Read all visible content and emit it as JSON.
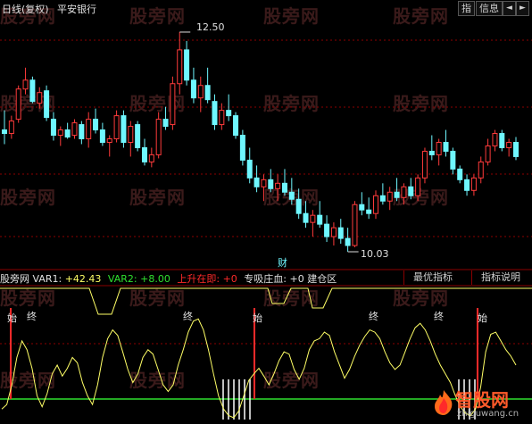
{
  "header": {
    "period": "日线(复权)",
    "stock_name": "平安银行",
    "buttons": [
      "指",
      "信息"
    ],
    "arrow_left": "◄",
    "arrow_right": "►"
  },
  "watermark": "股旁网",
  "price_panel": {
    "high_label": "12.50",
    "low_label": "10.03",
    "finance_marker": "财",
    "up_color": "#ff3b3b",
    "down_color": "#6ff7ff",
    "candles": [
      [
        11.4,
        11.62,
        11.24,
        11.36
      ],
      [
        11.36,
        11.56,
        11.3,
        11.5
      ],
      [
        11.52,
        11.9,
        11.48,
        11.86
      ],
      [
        11.86,
        12.1,
        11.8,
        11.96
      ],
      [
        11.96,
        12.0,
        11.7,
        11.72
      ],
      [
        11.7,
        11.88,
        11.64,
        11.82
      ],
      [
        11.84,
        11.9,
        11.5,
        11.54
      ],
      [
        11.52,
        11.6,
        11.28,
        11.34
      ],
      [
        11.34,
        11.44,
        11.22,
        11.4
      ],
      [
        11.4,
        11.48,
        11.3,
        11.32
      ],
      [
        11.34,
        11.52,
        11.3,
        11.48
      ],
      [
        11.46,
        11.5,
        11.24,
        11.3
      ],
      [
        11.3,
        11.6,
        11.2,
        11.52
      ],
      [
        11.52,
        11.64,
        11.36,
        11.4
      ],
      [
        11.4,
        11.48,
        11.22,
        11.26
      ],
      [
        11.26,
        11.34,
        11.1,
        11.3
      ],
      [
        11.3,
        11.62,
        11.26,
        11.56
      ],
      [
        11.56,
        11.62,
        11.2,
        11.26
      ],
      [
        11.26,
        11.5,
        11.1,
        11.44
      ],
      [
        11.46,
        11.5,
        11.16,
        11.2
      ],
      [
        11.2,
        11.3,
        11.0,
        11.04
      ],
      [
        11.04,
        11.2,
        10.98,
        11.12
      ],
      [
        11.12,
        11.6,
        11.08,
        11.52
      ],
      [
        11.52,
        11.66,
        11.4,
        11.44
      ],
      [
        11.46,
        12.0,
        11.4,
        11.92
      ],
      [
        11.92,
        12.5,
        11.8,
        12.3
      ],
      [
        12.3,
        12.4,
        11.9,
        11.96
      ],
      [
        11.96,
        12.1,
        11.7,
        11.76
      ],
      [
        11.76,
        12.0,
        11.6,
        11.9
      ],
      [
        11.9,
        12.1,
        11.7,
        11.74
      ],
      [
        11.72,
        11.8,
        11.4,
        11.46
      ],
      [
        11.46,
        11.7,
        11.4,
        11.62
      ],
      [
        11.62,
        11.8,
        11.5,
        11.56
      ],
      [
        11.56,
        11.6,
        11.3,
        11.34
      ],
      [
        11.34,
        11.4,
        11.0,
        11.06
      ],
      [
        11.06,
        11.2,
        10.8,
        10.86
      ],
      [
        10.86,
        11.0,
        10.7,
        10.76
      ],
      [
        10.76,
        10.9,
        10.6,
        10.84
      ],
      [
        10.84,
        10.96,
        10.7,
        10.74
      ],
      [
        10.74,
        10.9,
        10.6,
        10.8
      ],
      [
        10.8,
        10.96,
        10.66,
        10.7
      ],
      [
        10.7,
        10.86,
        10.56,
        10.62
      ],
      [
        10.62,
        10.74,
        10.4,
        10.46
      ],
      [
        10.46,
        10.6,
        10.3,
        10.36
      ],
      [
        10.36,
        10.5,
        10.2,
        10.44
      ],
      [
        10.44,
        10.6,
        10.3,
        10.34
      ],
      [
        10.34,
        10.44,
        10.14,
        10.2
      ],
      [
        10.2,
        10.36,
        10.1,
        10.3
      ],
      [
        10.3,
        10.4,
        10.12,
        10.18
      ],
      [
        10.18,
        10.3,
        10.03,
        10.1
      ],
      [
        10.1,
        10.6,
        10.08,
        10.56
      ],
      [
        10.56,
        10.7,
        10.44,
        10.5
      ],
      [
        10.5,
        10.64,
        10.4,
        10.46
      ],
      [
        10.46,
        10.72,
        10.4,
        10.66
      ],
      [
        10.66,
        10.8,
        10.56,
        10.6
      ],
      [
        10.6,
        10.76,
        10.5,
        10.7
      ],
      [
        10.7,
        10.86,
        10.6,
        10.64
      ],
      [
        10.64,
        10.8,
        10.56,
        10.76
      ],
      [
        10.76,
        10.86,
        10.62,
        10.66
      ],
      [
        10.66,
        10.9,
        10.6,
        10.86
      ],
      [
        10.86,
        11.2,
        10.8,
        11.16
      ],
      [
        11.16,
        11.34,
        11.06,
        11.12
      ],
      [
        11.12,
        11.3,
        11.0,
        11.26
      ],
      [
        11.26,
        11.4,
        11.1,
        11.16
      ],
      [
        11.16,
        11.2,
        10.9,
        10.96
      ],
      [
        10.96,
        11.0,
        10.8,
        10.84
      ],
      [
        10.84,
        10.9,
        10.66,
        10.72
      ],
      [
        10.72,
        10.9,
        10.66,
        10.86
      ],
      [
        10.86,
        11.1,
        10.8,
        11.04
      ],
      [
        11.04,
        11.3,
        11.0,
        11.22
      ],
      [
        11.22,
        11.4,
        11.16,
        11.36
      ],
      [
        11.36,
        11.4,
        11.16,
        11.2
      ],
      [
        11.2,
        11.3,
        11.1,
        11.26
      ],
      [
        11.26,
        11.32,
        11.06,
        11.1
      ]
    ]
  },
  "indicator_panel": {
    "name": "股旁网",
    "var1_label": "VAR1:",
    "var1_value": "+42.43",
    "var2_label": "VAR2:",
    "var2_value": "+8.00",
    "var3_label": "上升在即:",
    "var3_value": "+0",
    "var4_label": "专吸庄血:",
    "var4_value": "+0",
    "tail_text": "建仓区",
    "tabs": [
      "最优指标",
      "指标说明"
    ],
    "signal_start": "始",
    "signal_end": "终",
    "line_color": "#ffff66",
    "green_color": "#2fe02f",
    "signal_color": "#ff2a2a",
    "series": [
      8,
      12,
      30,
      55,
      70,
      62,
      45,
      20,
      10,
      22,
      40,
      48,
      38,
      45,
      55,
      50,
      32,
      20,
      12,
      30,
      55,
      72,
      80,
      75,
      60,
      44,
      32,
      40,
      55,
      62,
      58,
      44,
      30,
      24,
      30,
      48,
      62,
      78,
      88,
      90,
      80,
      62,
      40,
      20,
      8,
      2,
      0,
      6,
      20,
      34,
      40,
      45,
      38,
      30,
      40,
      52,
      60,
      58,
      44,
      35,
      45,
      62,
      70,
      72,
      78,
      75,
      60,
      48,
      36,
      44,
      56,
      66,
      74,
      80,
      78,
      72,
      60,
      50,
      44,
      48,
      60,
      72,
      82,
      86,
      80,
      70,
      58,
      48,
      40,
      32,
      20,
      10,
      4,
      2,
      8,
      28,
      60,
      76,
      78,
      70,
      62,
      56,
      48
    ]
  },
  "branding": {
    "logo_text": "智股网",
    "url": "zhiguwang.cn"
  }
}
